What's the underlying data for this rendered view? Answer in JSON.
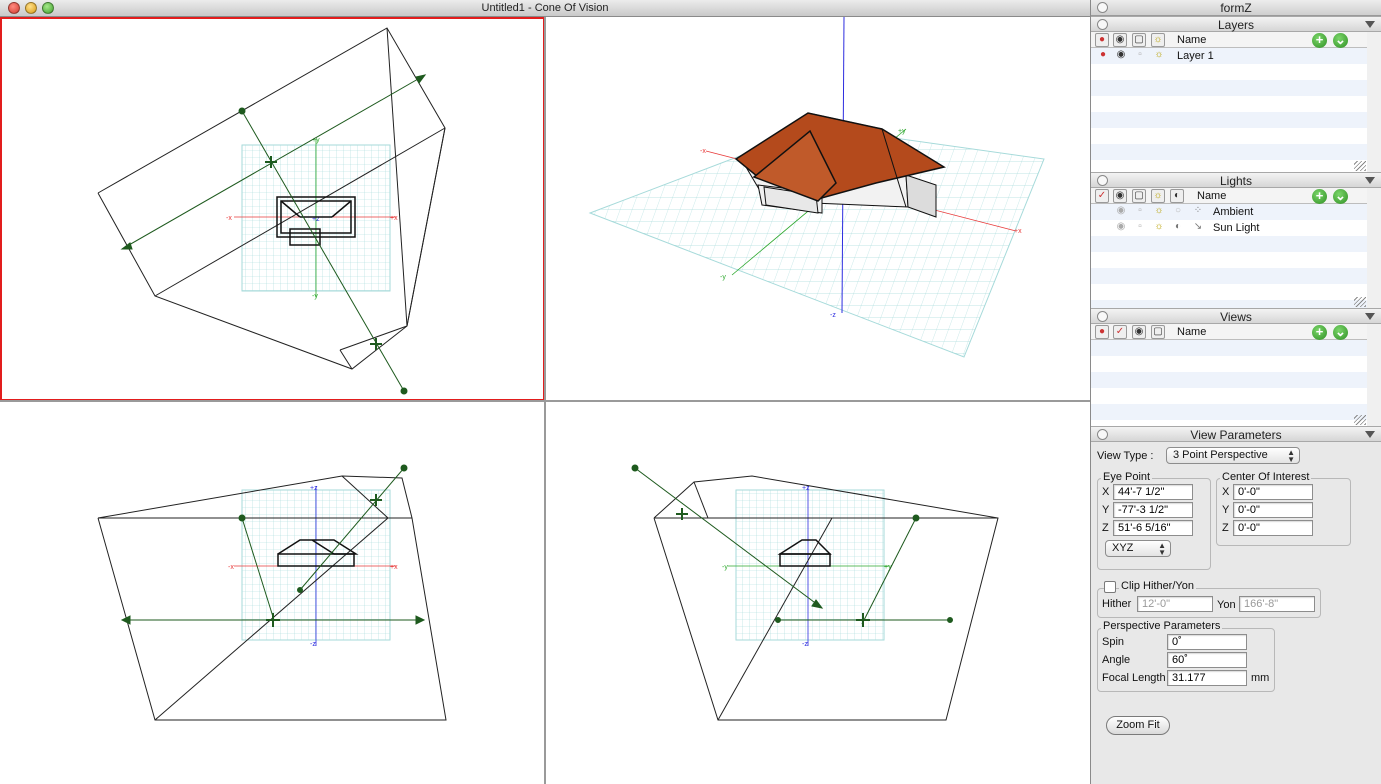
{
  "window": {
    "title": "Untitled1 - Cone Of Vision"
  },
  "colors": {
    "active_view_border": "#e21d1d",
    "grid": "#9fd6d6",
    "roof": "#b44a1c",
    "cone_line": "#1e5a1e",
    "axis_x": "#e83a3a",
    "axis_y": "#2ea82e",
    "axis_z": "#2d2de0"
  },
  "viewports": {
    "top_labels": {
      "plus_x": "+x",
      "minus_x": "-x",
      "plus_y": "+y",
      "minus_y": "-y",
      "z": "+z"
    },
    "persp_labels": {
      "plus_x": "+x",
      "minus_x": "-x",
      "plus_y": "+y",
      "minus_y": "-y",
      "plus_z": "+z",
      "minus_z": "-z"
    },
    "front_labels": {
      "plus_z": "+z",
      "minus_z": "-z",
      "plus_x": "+x",
      "minus_x": "-x"
    },
    "side_labels": {
      "plus_z": "+z",
      "minus_z": "-z",
      "plus_y": "+y",
      "minus_y": "-y"
    }
  },
  "palette": {
    "title": "formZ",
    "layers": {
      "title": "Layers",
      "column_name": "Name",
      "rows": [
        "Layer 1"
      ]
    },
    "lights": {
      "title": "Lights",
      "column_name": "Name",
      "rows": [
        "Ambient",
        "Sun Light"
      ]
    },
    "views": {
      "title": "Views",
      "column_name": "Name"
    },
    "view_parameters": {
      "title": "View Parameters",
      "view_type_label": "View Type  :",
      "view_type_value": "3 Point Perspective",
      "eye_point": {
        "label": "Eye Point",
        "x_label": "X",
        "x": "44'-7 1/2\"",
        "y_label": "Y",
        "y": "-77'-3 1/2\"",
        "z_label": "Z",
        "z": "51'-6 5/16\"",
        "plane": "XYZ"
      },
      "center_of_interest": {
        "label": "Center Of Interest",
        "x_label": "X",
        "x": "0'-0\"",
        "y_label": "Y",
        "y": "0'-0\"",
        "z_label": "Z",
        "z": "0'-0\""
      },
      "clip": {
        "label": "Clip Hither/Yon",
        "hither_label": "Hither",
        "hither": "12'-0\"",
        "yon_label": "Yon",
        "yon": "166'-8\""
      },
      "perspective": {
        "label": "Perspective Parameters",
        "spin_label": "Spin",
        "spin": "0˚",
        "angle_label": "Angle",
        "angle": "60˚",
        "focal_label": "Focal Length",
        "focal": "31.177",
        "focal_unit": "mm"
      },
      "zoom_fit": "Zoom Fit"
    }
  }
}
